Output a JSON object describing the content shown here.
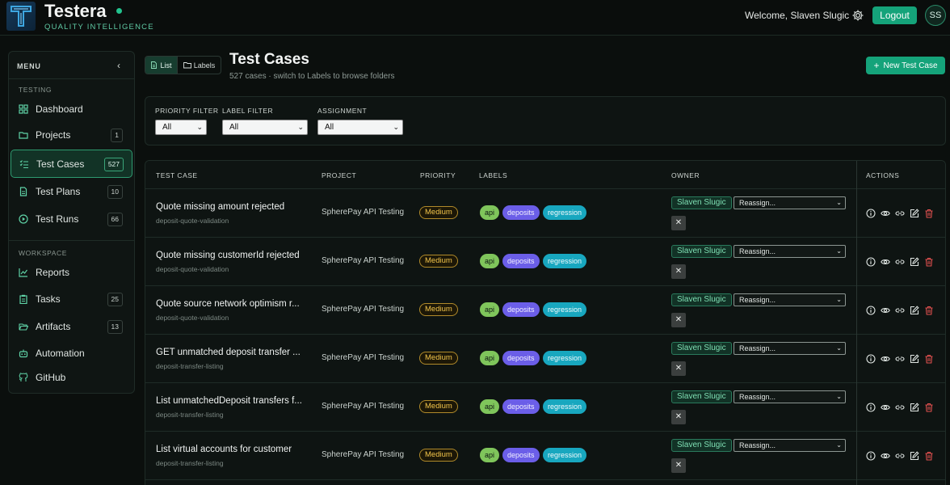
{
  "header": {
    "brand": "Testera",
    "tagline": "QUALITY INTELLIGENCE",
    "welcome": "Welcome, Slaven Slugic",
    "logout_label": "Logout",
    "avatar_initials": "SS"
  },
  "sidebar": {
    "menu_label": "MENU",
    "collapse_glyph": "‹",
    "sections": [
      {
        "label": "TESTING"
      },
      {
        "label": "WORKSPACE"
      }
    ],
    "items": [
      {
        "label": "Dashboard",
        "icon": "grid-icon"
      },
      {
        "label": "Projects",
        "icon": "folder-icon",
        "badge": "1"
      },
      {
        "label": "Test Cases",
        "icon": "checklist-icon",
        "badge": "527",
        "active": true
      },
      {
        "label": "Test Plans",
        "icon": "document-icon",
        "badge": "10"
      },
      {
        "label": "Test Runs",
        "icon": "play-icon",
        "badge": "66"
      },
      {
        "label": "Reports",
        "icon": "chart-icon"
      },
      {
        "label": "Tasks",
        "icon": "clipboard-icon",
        "badge": "25"
      },
      {
        "label": "Artifacts",
        "icon": "folder-open-icon",
        "badge": "13"
      },
      {
        "label": "Automation",
        "icon": "robot-icon"
      },
      {
        "label": "GitHub",
        "icon": "github-icon"
      }
    ]
  },
  "main": {
    "view_toggle": {
      "list": "List",
      "labels": "Labels"
    },
    "title": "Test Cases",
    "subtitle": "527 cases · switch to Labels to browse folders",
    "new_button": "New Test Case",
    "filters": [
      {
        "label": "PRIORITY FILTER",
        "value": "All"
      },
      {
        "label": "LABEL FILTER",
        "value": "All"
      },
      {
        "label": "ASSIGNMENT",
        "value": "All"
      }
    ]
  },
  "table": {
    "columns": [
      "TEST CASE",
      "PROJECT",
      "PRIORITY",
      "LABELS",
      "OWNER",
      "ACTIONS"
    ],
    "reassign_placeholder": "Reassign...",
    "unassign_glyph": "✕",
    "rows": [
      {
        "title": "Quote missing amount rejected",
        "folder": "deposit-quote-validation",
        "project": "SpherePay API Testing",
        "priority": "Medium",
        "labels": [
          "api",
          "deposits",
          "regression"
        ],
        "owner": "Slaven Slugic"
      },
      {
        "title": "Quote missing customerId rejected",
        "folder": "deposit-quote-validation",
        "project": "SpherePay API Testing",
        "priority": "Medium",
        "labels": [
          "api",
          "deposits",
          "regression"
        ],
        "owner": "Slaven Slugic"
      },
      {
        "title": "Quote source network optimism r...",
        "folder": "deposit-quote-validation",
        "project": "SpherePay API Testing",
        "priority": "Medium",
        "labels": [
          "api",
          "deposits",
          "regression"
        ],
        "owner": "Slaven Slugic"
      },
      {
        "title": "GET unmatched deposit transfer ...",
        "folder": "deposit-transfer-listing",
        "project": "SpherePay API Testing",
        "priority": "Medium",
        "labels": [
          "api",
          "deposits",
          "regression"
        ],
        "owner": "Slaven Slugic"
      },
      {
        "title": "List unmatchedDeposit transfers f...",
        "folder": "deposit-transfer-listing",
        "project": "SpherePay API Testing",
        "priority": "Medium",
        "labels": [
          "api",
          "deposits",
          "regression"
        ],
        "owner": "Slaven Slugic"
      },
      {
        "title": "List virtual accounts for customer",
        "folder": "deposit-transfer-listing",
        "project": "SpherePay API Testing",
        "priority": "Medium",
        "labels": [
          "api",
          "deposits",
          "regression"
        ],
        "owner": "Slaven Slugic"
      }
    ]
  },
  "colors": {
    "accent": "#15a37a",
    "priority_medium": "#f0c34a",
    "label_api": "#7fc55b",
    "label_deposits": "#6b5ee8",
    "label_regression": "#18a7bf",
    "danger": "#e0504f"
  }
}
